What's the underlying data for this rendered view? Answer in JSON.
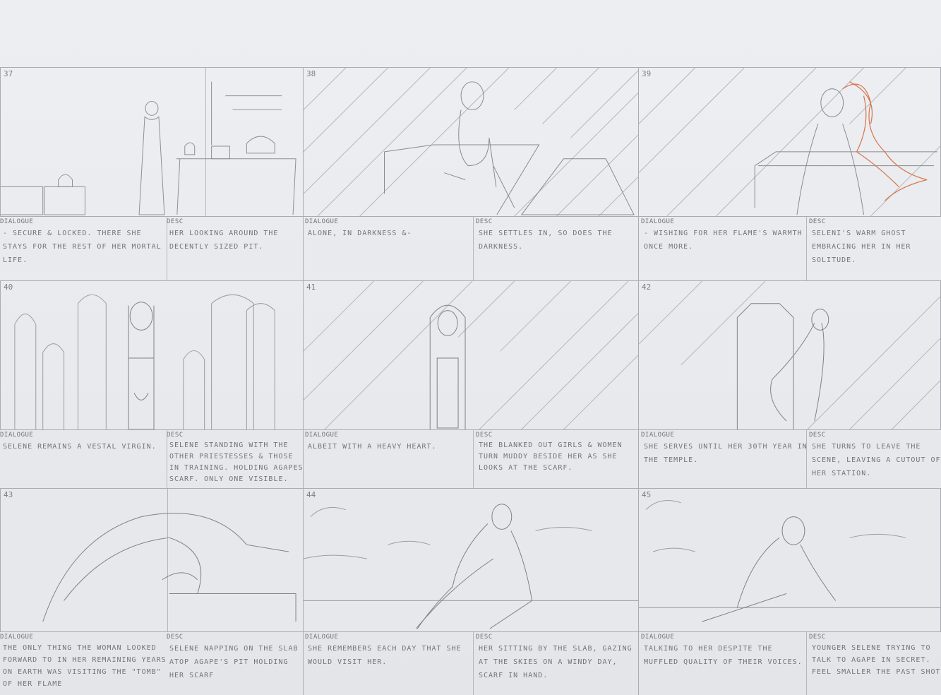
{
  "panels": [
    {
      "num": "37",
      "dialogue_label": "DIALOGUE",
      "dialogue": "- SECURE & LOCKED. THERE SHE STAYS FOR THE REST OF HER MORTAL LIFE.",
      "desc_label": "DESC",
      "desc": "HER LOOKING AROUND THE DECENTLY SIZED PIT."
    },
    {
      "num": "38",
      "dialogue_label": "DIALOGUE",
      "dialogue": "ALONE, IN DARKNESS &-",
      "desc_label": "DESC",
      "desc": "SHE SETTLES IN, SO DOES THE DARKNESS."
    },
    {
      "num": "39",
      "dialogue_label": "DIALOGUE",
      "dialogue": "- WISHING FOR HER FLAME'S WARMTH ONCE MORE.",
      "desc_label": "DESC",
      "desc": "SELENI'S WARM GHOST EMBRACING HER IN HER SOLITUDE."
    },
    {
      "num": "40",
      "dialogue_label": "DIALOGUE",
      "dialogue": "SELENE REMAINS A VESTAL VIRGIN.",
      "desc_label": "DESC",
      "desc": "SELENE STANDING WITH THE OTHER PRIESTESSES & THOSE IN TRAINING. HOLDING AGAPES SCARF. ONLY ONE VISIBLE."
    },
    {
      "num": "41",
      "dialogue_label": "DIALOGUE",
      "dialogue": "ALBEIT WITH A HEAVY HEART.",
      "desc_label": "DESC",
      "desc": "THE BLANKED OUT GIRLS & WOMEN TURN MUDDY BESIDE HER AS SHE LOOKS AT THE SCARF."
    },
    {
      "num": "42",
      "dialogue_label": "DIALOGUE",
      "dialogue": "SHE SERVES UNTIL HER 30TH YEAR IN THE TEMPLE.",
      "desc_label": "DESC",
      "desc": "SHE TURNS TO LEAVE THE SCENE, LEAVING A CUTOUT OF HER STATION."
    },
    {
      "num": "43",
      "dialogue_label": "DIALOGUE",
      "dialogue": "THE ONLY THING THE WOMAN LOOKED FORWARD TO IN HER REMAINING YEARS ON EARTH WAS VISITING THE \"TOMB\" OF HER FLAME",
      "desc_label": "DESC",
      "desc": "SELENE NAPPING ON THE SLAB ATOP AGAPE'S PIT HOLDING HER SCARF"
    },
    {
      "num": "44",
      "dialogue_label": "DIALOGUE",
      "dialogue": "SHE REMEMBERS EACH DAY THAT SHE WOULD VISIT HER.",
      "desc_label": "DESC",
      "desc": "HER SITTING BY THE SLAB, GAZING AT THE SKIES ON A WINDY DAY, SCARF IN HAND."
    },
    {
      "num": "45",
      "dialogue_label": "DIALOGUE",
      "dialogue": "TALKING TO HER DESPITE THE MUFFLED QUALITY OF THEIR VOICES.",
      "desc_label": "DESC",
      "desc": "YOUNGER SELENE TRYING TO TALK TO AGAPE IN SECRET. FEEL SMALLER THE PAST SHOT"
    }
  ]
}
